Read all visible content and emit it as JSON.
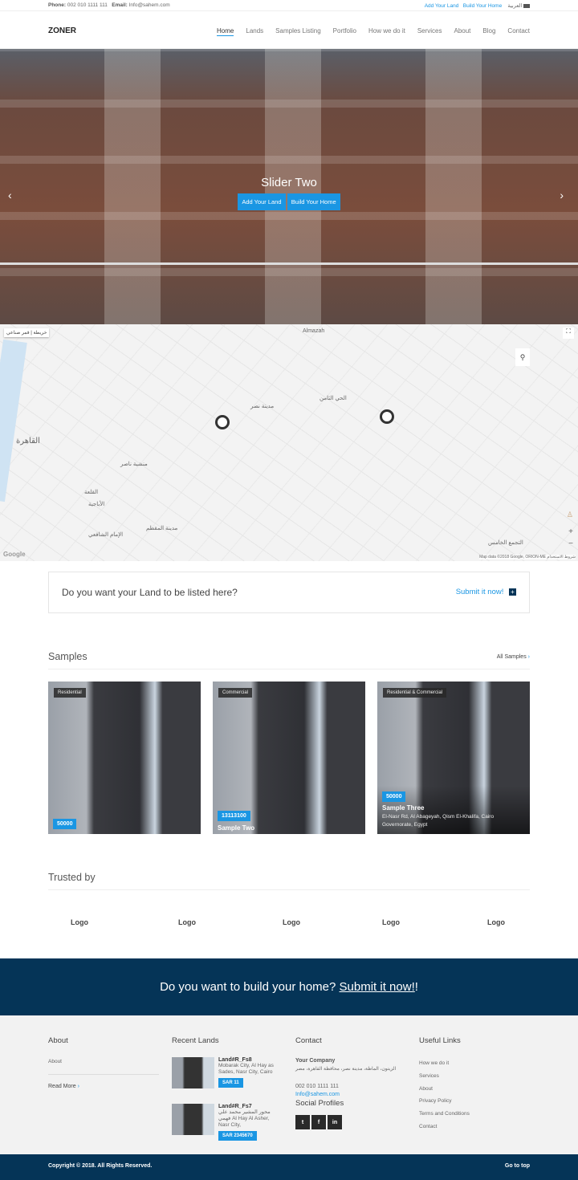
{
  "topbar": {
    "phone_label": "Phone:",
    "phone": "002 010 1111 111",
    "email_label": "Email:",
    "email": "Info@sahem.com",
    "links": [
      "Add Your Land",
      "Build Your Home"
    ],
    "language": "العربية"
  },
  "nav": {
    "brand": "ZONER",
    "items": [
      "Home",
      "Lands",
      "Samples Listing",
      "Portfolio",
      "How we do it",
      "Services",
      "About",
      "Blog",
      "Contact"
    ],
    "active": "Home"
  },
  "hero": {
    "title": "Slider Two",
    "buttons": [
      "Add Your Land",
      "Build Your Home"
    ]
  },
  "map": {
    "type_buttons": [
      "خريطة",
      "قمر صناعي"
    ],
    "labels": [
      "Almazah",
      "مدينة نصر",
      "القاهرة",
      "الحي الثامن",
      "منشية ناصر",
      "القلعة",
      "الأباجية",
      "مدينة المقطم",
      "الإمام الشافعي",
      "التجمع الخامس"
    ],
    "attribution": "Map data ©2018 Google, ORION-ME",
    "terms": "شروط الاستخدام",
    "google": "Google",
    "zoom_in": "+",
    "zoom_out": "−"
  },
  "cta": {
    "question": "Do you want your Land to be listed here?",
    "link": "Submit it now!"
  },
  "samples": {
    "title": "Samples",
    "all_link": "All Samples",
    "cards": [
      {
        "tag": "Residential",
        "price": "50000",
        "name": "",
        "address": ""
      },
      {
        "tag": "Commercial",
        "price": "13113100",
        "name": "Sample Two",
        "address": ""
      },
      {
        "tag": "Residential & Commercial",
        "price": "50000",
        "name": "Sample Three",
        "address": "El-Nasr Rd, Al Abageyah, Qism El-Khalifa, Cairo Governorate, Egypt"
      }
    ]
  },
  "trusted": {
    "title": "Trusted by",
    "logos": [
      "Logo",
      "Logo",
      "Logo",
      "Logo",
      "Logo"
    ]
  },
  "band": {
    "text": "Do you want to build your home?",
    "link": "Submit it now!",
    "suffix": "!"
  },
  "footer": {
    "about": {
      "title": "About",
      "text": "About",
      "read_more": "Read More"
    },
    "recent": {
      "title": "Recent Lands",
      "items": [
        {
          "name": "Land#R_Fs8",
          "address": "Mobarak City, Al Hay as Sades, Nasr City, Cairo",
          "price": "SAR 11"
        },
        {
          "name": "Land#R_Fs7",
          "address": "محور المشير محمد علي فهمي Al Hay Al Asher, Nasr City,",
          "price": "SAR 2345670"
        }
      ]
    },
    "contact": {
      "title": "Contact",
      "company": "Your Company",
      "address": "الزيتون، الماظة، مدينة نصر، محافظة القاهرة، مصر",
      "phone": "002 010 1111 111",
      "email": "Info@sahem.com",
      "social_title": "Social Profiles",
      "social": [
        "twitter",
        "facebook",
        "linkedin"
      ]
    },
    "links": {
      "title": "Useful Links",
      "items": [
        "How we do it",
        "Services",
        "About",
        "Privacy Policy",
        "Terms and Conditions",
        "Contact"
      ]
    }
  },
  "bottom": {
    "copyright": "Copyright © 2018. All Rights Reserved.",
    "to_top": "Go to top"
  },
  "colors": {
    "accent": "#1a96e3",
    "navy": "#053457"
  }
}
